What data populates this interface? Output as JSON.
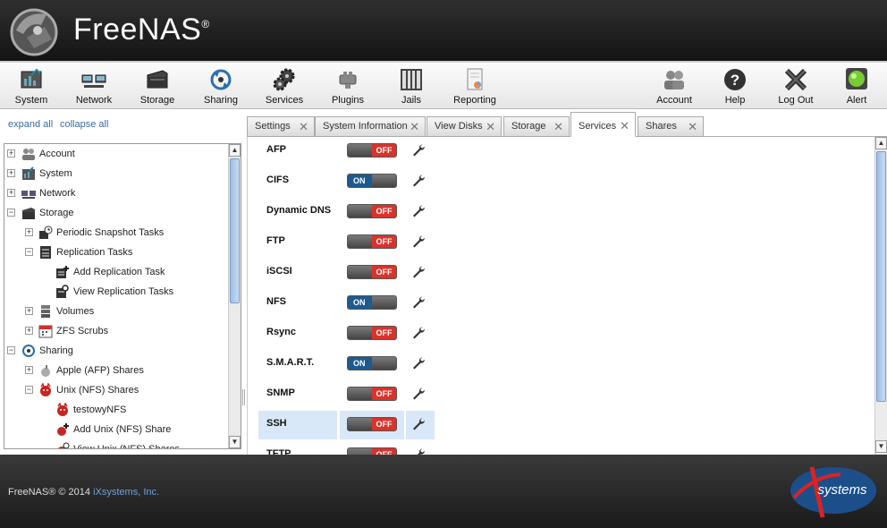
{
  "app": {
    "name": "FreeNAS",
    "reg": "®"
  },
  "toolbar": {
    "left": [
      {
        "label": "System",
        "icon": "system-icon"
      },
      {
        "label": "Network",
        "icon": "network-icon"
      },
      {
        "label": "Storage",
        "icon": "storage-icon"
      },
      {
        "label": "Sharing",
        "icon": "sharing-icon"
      },
      {
        "label": "Services",
        "icon": "services-icon"
      },
      {
        "label": "Plugins",
        "icon": "plugins-icon"
      },
      {
        "label": "Jails",
        "icon": "jails-icon"
      },
      {
        "label": "Reporting",
        "icon": "reporting-icon"
      }
    ],
    "right": [
      {
        "label": "Account",
        "icon": "account-icon"
      },
      {
        "label": "Help",
        "icon": "help-icon"
      },
      {
        "label": "Log Out",
        "icon": "logout-icon"
      },
      {
        "label": "Alert",
        "icon": "alert-icon"
      }
    ]
  },
  "sidebar": {
    "expand_all": "expand all",
    "collapse_all": "collapse all",
    "tree": [
      {
        "label": "Account",
        "expander": "+"
      },
      {
        "label": "System",
        "expander": "+"
      },
      {
        "label": "Network",
        "expander": "+"
      },
      {
        "label": "Storage",
        "expander": "−"
      },
      {
        "label": "Periodic Snapshot Tasks",
        "expander": "+"
      },
      {
        "label": "Replication Tasks",
        "expander": "−"
      },
      {
        "label": "Add Replication Task"
      },
      {
        "label": "View Replication Tasks"
      },
      {
        "label": "Volumes",
        "expander": "+"
      },
      {
        "label": "ZFS Scrubs",
        "expander": "+"
      },
      {
        "label": "Sharing",
        "expander": "−"
      },
      {
        "label": "Apple (AFP) Shares",
        "expander": "+"
      },
      {
        "label": "Unix (NFS) Shares",
        "expander": "−"
      },
      {
        "label": "testowyNFS"
      },
      {
        "label": "Add Unix (NFS) Share"
      },
      {
        "label": "View Unix (NFS) Shares"
      }
    ]
  },
  "tabs": [
    {
      "label": "Settings"
    },
    {
      "label": "System Information"
    },
    {
      "label": "View Disks"
    },
    {
      "label": "Storage"
    },
    {
      "label": "Services",
      "active": true
    },
    {
      "label": "Shares"
    }
  ],
  "toggle_labels": {
    "on": "ON",
    "off": "OFF"
  },
  "services": [
    {
      "name": "AFP",
      "state": "off"
    },
    {
      "name": "CIFS",
      "state": "on"
    },
    {
      "name": "Dynamic DNS",
      "state": "off"
    },
    {
      "name": "FTP",
      "state": "off"
    },
    {
      "name": "iSCSI",
      "state": "off"
    },
    {
      "name": "NFS",
      "state": "on"
    },
    {
      "name": "Rsync",
      "state": "off"
    },
    {
      "name": "S.M.A.R.T.",
      "state": "on"
    },
    {
      "name": "SNMP",
      "state": "off"
    },
    {
      "name": "SSH",
      "state": "off",
      "highlighted": true
    },
    {
      "name": "TFTP",
      "state": "off"
    }
  ],
  "footer": {
    "copyright": "FreeNAS® © 2014 ",
    "company": "iXsystems, Inc.",
    "logo_text": "systems"
  },
  "colors": {
    "on": "#1d5a8e",
    "off": "#d9332b",
    "link": "#3a6aa5",
    "highlight": "#d8e8f8"
  }
}
